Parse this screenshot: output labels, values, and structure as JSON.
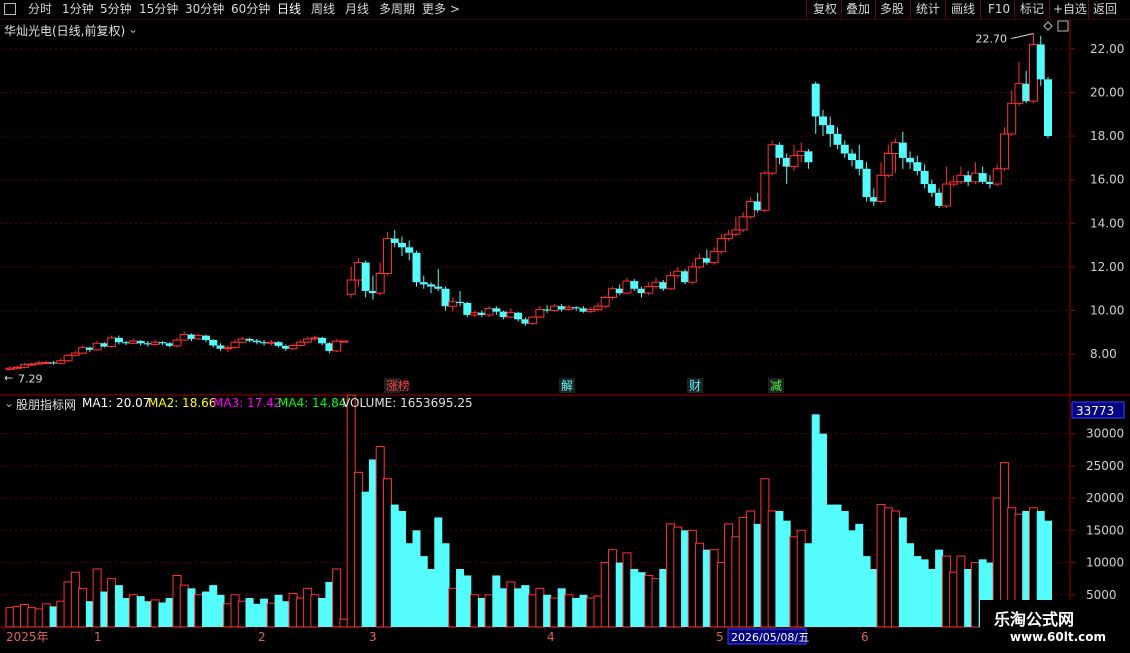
{
  "toolbar": {
    "left_items": [
      "分时",
      "1分钟",
      "5分钟",
      "15分钟",
      "30分钟",
      "60分钟",
      "日线",
      "周线",
      "月线",
      "多周期",
      "更多 >"
    ],
    "active": "日线",
    "right_items": [
      "复权",
      "叠加",
      "多股",
      "统计",
      "画线",
      "F10",
      "标记",
      "+自选",
      "返回"
    ]
  },
  "price_pane": {
    "title": "华灿光电(日线,前复权)",
    "high_label": "22.70",
    "low_label": "7.29",
    "y_ticks": [
      "22.00",
      "20.00",
      "18.00",
      "16.00",
      "14.00",
      "12.00",
      "10.00",
      "8.00"
    ],
    "events": [
      "涨榜",
      "解",
      "财",
      "减"
    ]
  },
  "volume_pane": {
    "indicator_name": "股朋指标网",
    "ma1_label": "MA1: 20.07",
    "ma2_label": "MA2: 18.66",
    "ma3_label": "MA3: 17.42",
    "ma4_label": "MA4: 14.84",
    "volume_label": "VOLUME: 1653695.25",
    "current_value": "33773",
    "y_ticks": [
      "30000",
      "25000",
      "20000",
      "15000",
      "10000",
      "5000"
    ]
  },
  "date_axis": {
    "labels": [
      "2025年",
      "1",
      "2",
      "3",
      "4",
      "5",
      "6"
    ],
    "cursor_date": "2026/05/08/五"
  },
  "watermark": {
    "line1": "乐淘公式网",
    "line2": "www.60lt.com"
  },
  "colors": {
    "up": "#ff3232",
    "down": "#54fcfc",
    "grid": "#7a0000",
    "axis_text": "#d0d0d0",
    "ma1": "#ffffff",
    "ma2": "#ffff00",
    "ma3": "#ff00ff",
    "ma4": "#00ff00"
  },
  "chart_data": {
    "type": "candlestick",
    "price_range": [
      7.0,
      23.0
    ],
    "volume_range": [
      0,
      36000
    ],
    "candles": [
      [
        7.3,
        7.36,
        7.45,
        7.25,
        3000
      ],
      [
        7.36,
        7.4,
        7.48,
        7.3,
        3200
      ],
      [
        7.4,
        7.52,
        7.6,
        7.35,
        3500
      ],
      [
        7.52,
        7.55,
        7.62,
        7.45,
        3000
      ],
      [
        7.55,
        7.6,
        7.7,
        7.5,
        2800
      ],
      [
        7.6,
        7.62,
        7.7,
        7.55,
        3600
      ],
      [
        7.62,
        7.58,
        7.68,
        7.52,
        3200
      ],
      [
        7.58,
        7.7,
        7.8,
        7.55,
        4000
      ],
      [
        7.7,
        7.95,
        8.0,
        7.65,
        7000
      ],
      [
        7.95,
        8.05,
        8.15,
        7.9,
        8500
      ],
      [
        8.05,
        8.3,
        8.4,
        8.0,
        6000
      ],
      [
        8.3,
        8.2,
        8.35,
        8.1,
        4000
      ],
      [
        8.2,
        8.5,
        8.6,
        8.15,
        9000
      ],
      [
        8.5,
        8.35,
        8.55,
        8.3,
        5500
      ],
      [
        8.35,
        8.75,
        8.85,
        8.3,
        7500
      ],
      [
        8.75,
        8.55,
        8.85,
        8.45,
        6500
      ],
      [
        8.55,
        8.5,
        8.62,
        8.42,
        4500
      ],
      [
        8.5,
        8.6,
        8.7,
        8.45,
        5000
      ],
      [
        8.6,
        8.5,
        8.65,
        8.4,
        4800
      ],
      [
        8.5,
        8.45,
        8.6,
        8.35,
        4000
      ],
      [
        8.45,
        8.55,
        8.65,
        8.4,
        4200
      ],
      [
        8.55,
        8.5,
        8.6,
        8.42,
        3800
      ],
      [
        8.5,
        8.38,
        8.55,
        8.3,
        4500
      ],
      [
        8.38,
        8.65,
        8.75,
        8.3,
        8000
      ],
      [
        8.65,
        8.9,
        9.05,
        8.6,
        6500
      ],
      [
        8.9,
        8.7,
        8.95,
        8.6,
        6000
      ],
      [
        8.7,
        8.85,
        8.95,
        8.65,
        5000
      ],
      [
        8.85,
        8.65,
        8.9,
        8.55,
        5500
      ],
      [
        8.65,
        8.4,
        8.7,
        8.3,
        6500
      ],
      [
        8.4,
        8.25,
        8.5,
        8.15,
        5000
      ],
      [
        8.25,
        8.3,
        8.4,
        8.1,
        3600
      ],
      [
        8.3,
        8.55,
        8.65,
        8.25,
        5000
      ],
      [
        8.55,
        8.7,
        8.8,
        8.5,
        4000
      ],
      [
        8.7,
        8.62,
        8.75,
        8.55,
        4500
      ],
      [
        8.62,
        8.55,
        8.7,
        8.45,
        3600
      ],
      [
        8.55,
        8.5,
        8.65,
        8.4,
        4400
      ],
      [
        8.5,
        8.55,
        8.65,
        8.4,
        3700
      ],
      [
        8.55,
        8.38,
        8.6,
        8.3,
        5000
      ],
      [
        8.38,
        8.25,
        8.45,
        8.15,
        4000
      ],
      [
        8.25,
        8.4,
        8.5,
        8.2,
        5200
      ],
      [
        8.4,
        8.55,
        8.65,
        8.35,
        4500
      ],
      [
        8.55,
        8.7,
        8.8,
        8.5,
        6000
      ],
      [
        8.7,
        8.75,
        8.85,
        8.6,
        5000
      ],
      [
        8.75,
        8.5,
        8.8,
        8.4,
        4500
      ],
      [
        8.5,
        8.15,
        8.55,
        8.05,
        7000
      ],
      [
        8.15,
        8.6,
        8.7,
        8.1,
        9000
      ],
      [
        8.6,
        8.6,
        8.6,
        8.6,
        1200
      ],
      [
        10.75,
        11.4,
        12.0,
        10.6,
        36000
      ],
      [
        11.4,
        12.2,
        12.4,
        11.1,
        24000
      ],
      [
        12.2,
        10.9,
        12.3,
        10.6,
        21000
      ],
      [
        10.9,
        10.8,
        11.6,
        10.5,
        26000
      ],
      [
        10.8,
        11.7,
        12.2,
        10.7,
        28000
      ],
      [
        11.7,
        13.3,
        13.6,
        11.6,
        23000
      ],
      [
        13.3,
        13.1,
        13.7,
        12.9,
        19000
      ],
      [
        13.1,
        12.9,
        13.4,
        12.5,
        18000
      ],
      [
        12.9,
        12.65,
        13.2,
        12.3,
        13000
      ],
      [
        12.65,
        11.3,
        12.75,
        11.1,
        15000
      ],
      [
        11.3,
        11.2,
        11.6,
        11.0,
        11000
      ],
      [
        11.2,
        11.1,
        11.3,
        10.8,
        9000
      ],
      [
        11.1,
        11.0,
        11.9,
        10.9,
        17000
      ],
      [
        11.0,
        10.2,
        11.1,
        10.0,
        13000
      ],
      [
        10.2,
        10.4,
        10.6,
        9.95,
        6000
      ],
      [
        10.4,
        10.35,
        10.9,
        10.2,
        9000
      ],
      [
        10.35,
        9.8,
        10.4,
        9.7,
        8000
      ],
      [
        9.8,
        9.9,
        10.0,
        9.7,
        5000
      ],
      [
        9.9,
        9.8,
        10.0,
        9.7,
        4500
      ],
      [
        9.8,
        10.1,
        10.2,
        9.7,
        5000
      ],
      [
        10.1,
        9.95,
        10.2,
        9.8,
        8000
      ],
      [
        9.95,
        9.7,
        10.0,
        9.6,
        6000
      ],
      [
        9.7,
        9.9,
        10.1,
        9.65,
        7000
      ],
      [
        9.9,
        9.6,
        9.95,
        9.5,
        6000
      ],
      [
        9.6,
        9.4,
        9.7,
        9.3,
        6500
      ],
      [
        9.4,
        9.7,
        9.75,
        9.35,
        5000
      ],
      [
        9.7,
        10.05,
        10.2,
        9.65,
        6000
      ],
      [
        10.05,
        10.0,
        10.25,
        9.9,
        5000
      ],
      [
        10.0,
        10.2,
        10.3,
        9.95,
        4500
      ],
      [
        10.2,
        10.05,
        10.3,
        9.95,
        6000
      ],
      [
        10.05,
        10.15,
        10.25,
        10.0,
        5000
      ],
      [
        10.15,
        10.1,
        10.2,
        10.0,
        4500
      ],
      [
        10.1,
        9.95,
        10.2,
        9.9,
        5000
      ],
      [
        9.95,
        10.05,
        10.15,
        9.9,
        4500
      ],
      [
        10.05,
        10.2,
        10.35,
        9.95,
        4800
      ],
      [
        10.2,
        10.6,
        10.7,
        10.1,
        10000
      ],
      [
        10.6,
        11.0,
        11.1,
        10.5,
        12000
      ],
      [
        11.0,
        10.8,
        11.2,
        10.7,
        10000
      ],
      [
        10.8,
        11.35,
        11.5,
        10.75,
        11500
      ],
      [
        11.35,
        11.0,
        11.45,
        10.9,
        9000
      ],
      [
        11.0,
        10.8,
        11.1,
        10.6,
        8500
      ],
      [
        10.8,
        11.1,
        11.3,
        10.7,
        8000
      ],
      [
        11.1,
        11.3,
        11.5,
        11.0,
        7500
      ],
      [
        11.3,
        11.0,
        11.4,
        10.9,
        9000
      ],
      [
        11.0,
        11.6,
        11.8,
        10.95,
        16000
      ],
      [
        11.6,
        11.8,
        12.0,
        11.5,
        15500
      ],
      [
        11.8,
        11.3,
        11.9,
        11.2,
        15000
      ],
      [
        11.3,
        12.0,
        12.2,
        11.2,
        15000
      ],
      [
        12.0,
        12.4,
        12.6,
        11.9,
        13000
      ],
      [
        12.4,
        12.2,
        12.8,
        12.1,
        12000
      ],
      [
        12.2,
        12.7,
        12.9,
        12.1,
        12000
      ],
      [
        12.7,
        13.3,
        13.5,
        12.6,
        10000
      ],
      [
        13.3,
        13.5,
        13.7,
        13.2,
        16000
      ],
      [
        13.5,
        13.7,
        14.3,
        13.4,
        14000
      ],
      [
        13.7,
        14.3,
        14.5,
        13.6,
        17000
      ],
      [
        14.3,
        15.0,
        15.2,
        14.2,
        18000
      ],
      [
        15.0,
        14.6,
        15.4,
        14.5,
        16000
      ],
      [
        14.6,
        16.3,
        16.4,
        14.5,
        23000
      ],
      [
        16.3,
        17.6,
        17.8,
        16.2,
        18000
      ],
      [
        17.6,
        17.0,
        17.7,
        16.7,
        18000
      ],
      [
        17.0,
        16.6,
        17.2,
        15.8,
        16500
      ],
      [
        16.6,
        17.1,
        17.6,
        16.4,
        14000
      ],
      [
        17.1,
        17.3,
        17.7,
        16.8,
        15000
      ],
      [
        17.3,
        16.8,
        17.4,
        16.5,
        13000
      ],
      [
        20.4,
        18.9,
        20.5,
        18.1,
        33000
      ],
      [
        18.9,
        18.5,
        19.2,
        18.0,
        30000
      ],
      [
        18.5,
        18.1,
        18.9,
        17.5,
        19000
      ],
      [
        18.1,
        17.6,
        18.4,
        17.4,
        19000
      ],
      [
        17.6,
        17.2,
        17.8,
        17.0,
        18000
      ],
      [
        17.2,
        16.9,
        17.4,
        16.6,
        15000
      ],
      [
        16.9,
        16.5,
        17.6,
        16.2,
        16000
      ],
      [
        16.5,
        15.2,
        16.8,
        15.0,
        11000
      ],
      [
        15.2,
        15.0,
        15.6,
        14.8,
        9000
      ],
      [
        15.0,
        16.2,
        16.8,
        14.9,
        19000
      ],
      [
        16.2,
        17.2,
        17.6,
        16.1,
        18500
      ],
      [
        17.2,
        17.7,
        17.9,
        16.3,
        18000
      ],
      [
        17.7,
        17.0,
        18.2,
        16.5,
        17000
      ],
      [
        17.0,
        16.8,
        17.3,
        16.5,
        13000
      ],
      [
        16.8,
        16.4,
        17.1,
        16.2,
        11000
      ],
      [
        16.4,
        15.8,
        16.7,
        15.6,
        10500
      ],
      [
        15.8,
        15.4,
        16.0,
        15.2,
        9000
      ],
      [
        15.4,
        14.8,
        15.6,
        14.7,
        12000
      ],
      [
        14.8,
        15.8,
        16.6,
        14.7,
        11000
      ],
      [
        15.8,
        15.9,
        16.2,
        15.7,
        8500
      ],
      [
        15.9,
        16.2,
        16.6,
        15.8,
        11000
      ],
      [
        16.2,
        15.9,
        16.4,
        15.7,
        9000
      ],
      [
        15.9,
        16.3,
        16.8,
        15.8,
        10000
      ],
      [
        16.3,
        15.9,
        16.6,
        15.8,
        10500
      ],
      [
        15.9,
        15.8,
        16.2,
        15.6,
        10000
      ],
      [
        15.8,
        16.5,
        16.7,
        15.7,
        20000
      ],
      [
        16.5,
        18.1,
        18.4,
        16.4,
        25500
      ],
      [
        18.1,
        19.5,
        20.1,
        18.0,
        18500
      ],
      [
        19.5,
        20.4,
        21.4,
        19.4,
        17500
      ],
      [
        20.4,
        19.6,
        21.0,
        19.5,
        18000
      ],
      [
        19.6,
        22.2,
        22.7,
        19.5,
        18500
      ],
      [
        22.2,
        20.6,
        22.6,
        20.3,
        18000
      ],
      [
        20.6,
        18.0,
        20.7,
        17.9,
        16500
      ]
    ]
  }
}
